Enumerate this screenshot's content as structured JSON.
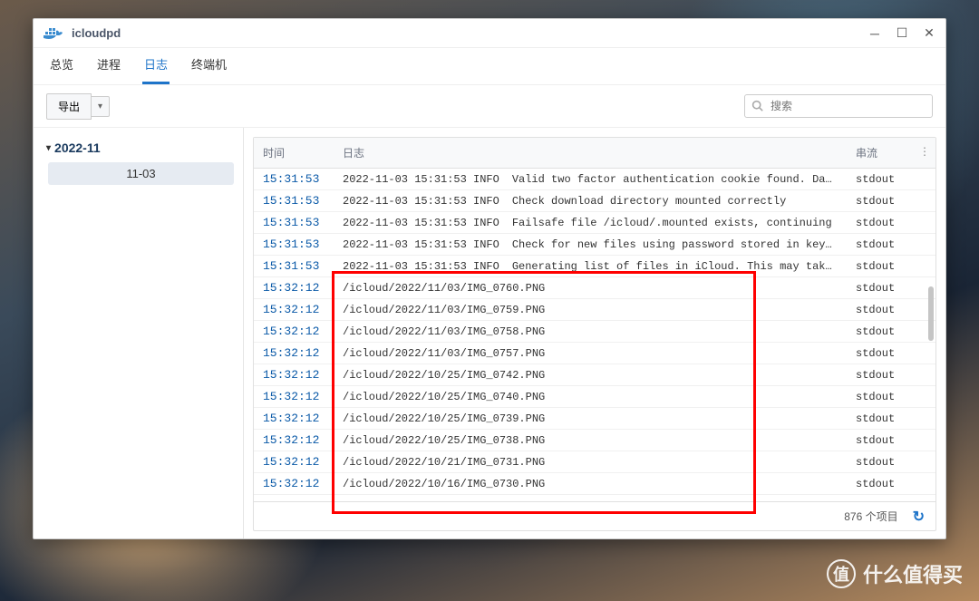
{
  "window": {
    "title": "icloudpd"
  },
  "tabs": [
    {
      "label": "总览"
    },
    {
      "label": "进程"
    },
    {
      "label": "日志"
    },
    {
      "label": "终端机"
    }
  ],
  "active_tab": 2,
  "toolbar": {
    "export_label": "导出"
  },
  "search": {
    "placeholder": "搜索"
  },
  "sidebar": {
    "group": "2022-11",
    "selected": "11-03"
  },
  "columns": {
    "time": "时间",
    "log": "日志",
    "stream": "串流"
  },
  "rows": [
    {
      "time": "15:31:53",
      "ts": "2022-11-03 15:31:53 INFO",
      "msg": "Valid two factor authentication cookie found. Days unt…",
      "stream": "stdout"
    },
    {
      "time": "15:31:53",
      "ts": "2022-11-03 15:31:53 INFO",
      "msg": "Check download directory mounted correctly",
      "stream": "stdout"
    },
    {
      "time": "15:31:53",
      "ts": "2022-11-03 15:31:53 INFO",
      "msg": "Failsafe file /icloud/.mounted exists, continuing",
      "stream": "stdout"
    },
    {
      "time": "15:31:53",
      "ts": "2022-11-03 15:31:53 INFO",
      "msg": "Check for new files using password stored in keyring f…",
      "stream": "stdout"
    },
    {
      "time": "15:31:53",
      "ts": "2022-11-03 15:31:53 INFO",
      "msg": "Generating list of files in iCloud. This may take a lo…",
      "stream": "stdout"
    },
    {
      "time": "15:32:12",
      "ts": "",
      "msg": "/icloud/2022/11/03/IMG_0760.PNG",
      "stream": "stdout"
    },
    {
      "time": "15:32:12",
      "ts": "",
      "msg": "/icloud/2022/11/03/IMG_0759.PNG",
      "stream": "stdout"
    },
    {
      "time": "15:32:12",
      "ts": "",
      "msg": "/icloud/2022/11/03/IMG_0758.PNG",
      "stream": "stdout"
    },
    {
      "time": "15:32:12",
      "ts": "",
      "msg": "/icloud/2022/11/03/IMG_0757.PNG",
      "stream": "stdout"
    },
    {
      "time": "15:32:12",
      "ts": "",
      "msg": "/icloud/2022/10/25/IMG_0742.PNG",
      "stream": "stdout"
    },
    {
      "time": "15:32:12",
      "ts": "",
      "msg": "/icloud/2022/10/25/IMG_0740.PNG",
      "stream": "stdout"
    },
    {
      "time": "15:32:12",
      "ts": "",
      "msg": "/icloud/2022/10/25/IMG_0739.PNG",
      "stream": "stdout"
    },
    {
      "time": "15:32:12",
      "ts": "",
      "msg": "/icloud/2022/10/25/IMG_0738.PNG",
      "stream": "stdout"
    },
    {
      "time": "15:32:12",
      "ts": "",
      "msg": "/icloud/2022/10/21/IMG_0731.PNG",
      "stream": "stdout"
    },
    {
      "time": "15:32:12",
      "ts": "",
      "msg": "/icloud/2022/10/16/IMG_0730.PNG",
      "stream": "stdout"
    }
  ],
  "footer": {
    "count_text": "876 个项目"
  },
  "watermark": {
    "text": "什么值得买",
    "icon_text": "值"
  }
}
